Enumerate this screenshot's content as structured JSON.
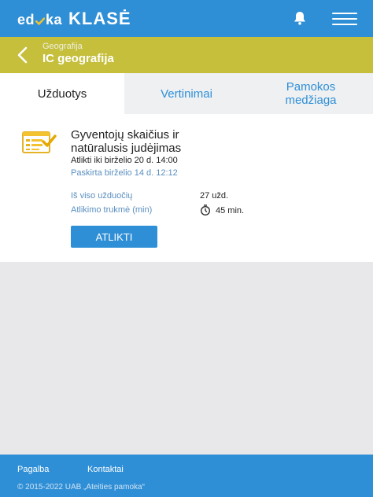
{
  "header": {
    "logo_edu": "ed",
    "logo_edu_tail": "ka",
    "logo_klase": "KLASĖ",
    "notifications_icon": "bell-icon",
    "menu_icon": "hamburger-menu-icon",
    "bar_color": "#2f8fd6"
  },
  "subject_bar": {
    "back_icon": "chevron-left-icon",
    "subject_label": "Geografija",
    "class_name": "IC geografija",
    "bar_color": "#c5bf3c"
  },
  "tabs": [
    {
      "label": "Užduotys",
      "active": true
    },
    {
      "label": "Vertinimai",
      "active": false
    },
    {
      "label": "Pamokos medžiaga",
      "active": false
    }
  ],
  "task": {
    "icon": "assignment-checklist-icon",
    "title": "Gyventojų skaičius ir natūralusis judėjimas",
    "due": "Atlikti iki birželio 20 d. 14:00",
    "assigned": "Paskirta birželio 14 d. 12:12",
    "total_label": "Iš viso užduočių",
    "total_value": "27 užd.",
    "duration_label": "Atlikimo trukmė (min)",
    "duration_icon": "stopwatch-icon",
    "duration_value": "45 min.",
    "action_label": "ATLIKTI"
  },
  "footer": {
    "help": "Pagalba",
    "contacts": "Kontaktai",
    "copyright": "© 2015-2022 UAB „Ateities pamoka“"
  }
}
